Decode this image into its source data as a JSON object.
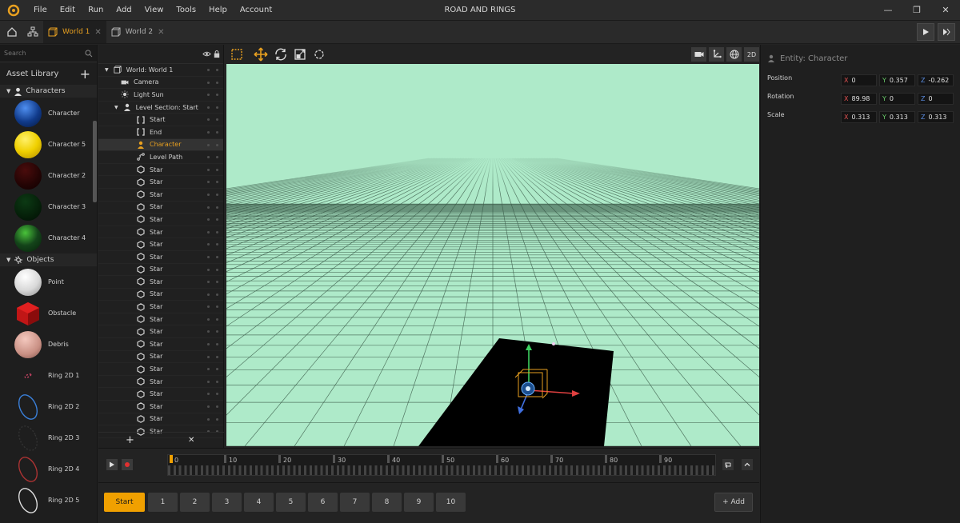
{
  "app": {
    "title": "ROAD AND RINGS"
  },
  "menu": [
    "File",
    "Edit",
    "Run",
    "Add",
    "View",
    "Tools",
    "Help",
    "Account"
  ],
  "tabs": [
    {
      "label": "World 1",
      "active": true
    },
    {
      "label": "World 2",
      "active": false
    }
  ],
  "search": {
    "placeholder": "Search"
  },
  "asset_library": {
    "title": "Asset Library",
    "categories": [
      {
        "name": "Characters",
        "items": [
          "Character",
          "Character 5",
          "Character 2",
          "Character 3",
          "Character 4"
        ]
      },
      {
        "name": "Objects",
        "items": [
          "Point",
          "Obstacle",
          "Debris",
          "Ring 2D 1",
          "Ring 2D 2",
          "Ring 2D 3",
          "Ring 2D 4",
          "Ring 2D 5"
        ]
      }
    ]
  },
  "outliner": {
    "rows": [
      {
        "label": "World: World 1",
        "icon": "world-icon",
        "depth": 0,
        "expand": true
      },
      {
        "label": "Camera",
        "icon": "camera-icon",
        "depth": 1
      },
      {
        "label": "Light Sun",
        "icon": "sun-icon",
        "depth": 1
      },
      {
        "label": "Level Section: Start",
        "icon": "person-icon",
        "depth": 1,
        "expand": true
      },
      {
        "label": "Start",
        "icon": "bracket-icon",
        "depth": 2
      },
      {
        "label": "End",
        "icon": "bracket-icon",
        "depth": 2
      },
      {
        "label": "Character",
        "icon": "person-icon",
        "depth": 2,
        "selected": true
      },
      {
        "label": "Level Path",
        "icon": "path-icon",
        "depth": 2
      },
      {
        "label": "Star",
        "icon": "hexagon-icon",
        "depth": 2
      },
      {
        "label": "Star",
        "icon": "hexagon-icon",
        "depth": 2
      },
      {
        "label": "Star",
        "icon": "hexagon-icon",
        "depth": 2
      },
      {
        "label": "Star",
        "icon": "hexagon-icon",
        "depth": 2
      },
      {
        "label": "Star",
        "icon": "hexagon-icon",
        "depth": 2
      },
      {
        "label": "Star",
        "icon": "hexagon-icon",
        "depth": 2
      },
      {
        "label": "Star",
        "icon": "hexagon-icon",
        "depth": 2
      },
      {
        "label": "Star",
        "icon": "hexagon-icon",
        "depth": 2
      },
      {
        "label": "Star",
        "icon": "hexagon-icon",
        "depth": 2
      },
      {
        "label": "Star",
        "icon": "hexagon-icon",
        "depth": 2
      },
      {
        "label": "Star",
        "icon": "hexagon-icon",
        "depth": 2
      },
      {
        "label": "Star",
        "icon": "hexagon-icon",
        "depth": 2
      },
      {
        "label": "Star",
        "icon": "hexagon-icon",
        "depth": 2
      },
      {
        "label": "Star",
        "icon": "hexagon-icon",
        "depth": 2
      },
      {
        "label": "Star",
        "icon": "hexagon-icon",
        "depth": 2
      },
      {
        "label": "Star",
        "icon": "hexagon-icon",
        "depth": 2
      },
      {
        "label": "Star",
        "icon": "hexagon-icon",
        "depth": 2
      },
      {
        "label": "Star",
        "icon": "hexagon-icon",
        "depth": 2
      },
      {
        "label": "Star",
        "icon": "hexagon-icon",
        "depth": 2
      },
      {
        "label": "Star",
        "icon": "hexagon-icon",
        "depth": 2
      },
      {
        "label": "Star",
        "icon": "hexagon-icon",
        "depth": 2
      },
      {
        "label": "Star",
        "icon": "hexagon-icon",
        "depth": 2
      }
    ]
  },
  "viewport": {
    "mode_label": "2D",
    "sky_color": "#aeeac9",
    "ground_color": "#000000"
  },
  "properties": {
    "entity_label": "Entity: Character",
    "rows": [
      {
        "label": "Position",
        "x": "0",
        "y": "0.357",
        "z": "-0.262"
      },
      {
        "label": "Rotation",
        "x": "89.98",
        "y": "0",
        "z": "0"
      },
      {
        "label": "Scale",
        "x": "0.313",
        "y": "0.313",
        "z": "0.313"
      }
    ],
    "axis_labels": {
      "x": "X",
      "y": "Y",
      "z": "Z"
    }
  },
  "timeline": {
    "ticks": [
      "0",
      "10",
      "20",
      "30",
      "40",
      "50",
      "60",
      "70",
      "80",
      "90"
    ]
  },
  "levels": {
    "start_label": "Start",
    "buttons": [
      "1",
      "2",
      "3",
      "4",
      "5",
      "6",
      "7",
      "8",
      "9",
      "10"
    ],
    "add_label": "+ Add"
  },
  "colors": {
    "accent": "#f0a000",
    "selected_text": "#e8a020"
  }
}
